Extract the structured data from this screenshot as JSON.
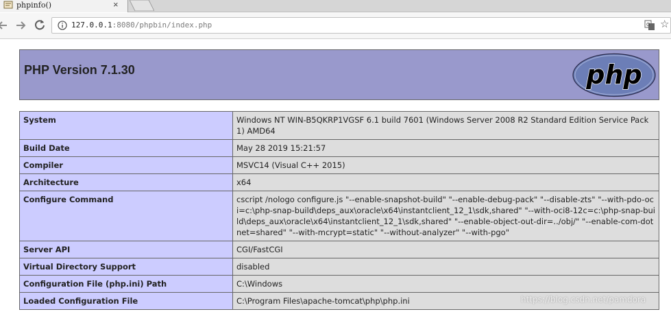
{
  "browser": {
    "tab": {
      "title": "phpinfo()",
      "favicon": "document-icon",
      "close": "×"
    },
    "address_bar": {
      "url_host": "127.0.0.1",
      "url_rest": ":8080/phpbin/index.php"
    },
    "icons": [
      "back-arrow-icon",
      "forward-arrow-icon",
      "reload-icon",
      "info-icon",
      "translate-icon",
      "star-icon"
    ],
    "bookmark_star": "☆"
  },
  "page": {
    "header": {
      "title": "PHP Version 7.1.30",
      "logo_text": "php"
    },
    "rows": [
      {
        "key": "System",
        "value": "Windows NT WIN-B5QKRP1VGSF 6.1 build 7601 (Windows Server 2008 R2 Standard Edition Service Pack 1) AMD64"
      },
      {
        "key": "Build Date",
        "value": "May 28 2019 15:21:57"
      },
      {
        "key": "Compiler",
        "value": "MSVC14 (Visual C++ 2015)"
      },
      {
        "key": "Architecture",
        "value": "x64"
      },
      {
        "key": "Configure Command",
        "value": "cscript /nologo configure.js \"--enable-snapshot-build\" \"--enable-debug-pack\" \"--disable-zts\" \"--with-pdo-oci=c:\\php-snap-build\\deps_aux\\oracle\\x64\\instantclient_12_1\\sdk,shared\" \"--with-oci8-12c=c:\\php-snap-build\\deps_aux\\oracle\\x64\\instantclient_12_1\\sdk,shared\" \"--enable-object-out-dir=../obj/\" \"--enable-com-dotnet=shared\" \"--with-mcrypt=static\" \"--without-analyzer\" \"--with-pgo\""
      },
      {
        "key": "Server API",
        "value": "CGI/FastCGI"
      },
      {
        "key": "Virtual Directory Support",
        "value": "disabled"
      },
      {
        "key": "Configuration File (php.ini) Path",
        "value": "C:\\Windows"
      },
      {
        "key": "Loaded Configuration File",
        "value": "C:\\Program Files\\apache-tomcat\\php\\php.ini"
      }
    ]
  },
  "watermark": "https://blog.csdn.net/pamdora",
  "colors": {
    "header_bg": "#9999cc",
    "key_bg": "#ccccff",
    "value_bg": "#dddddd",
    "border": "#666666",
    "logo_fill": "#6c7eb7"
  }
}
